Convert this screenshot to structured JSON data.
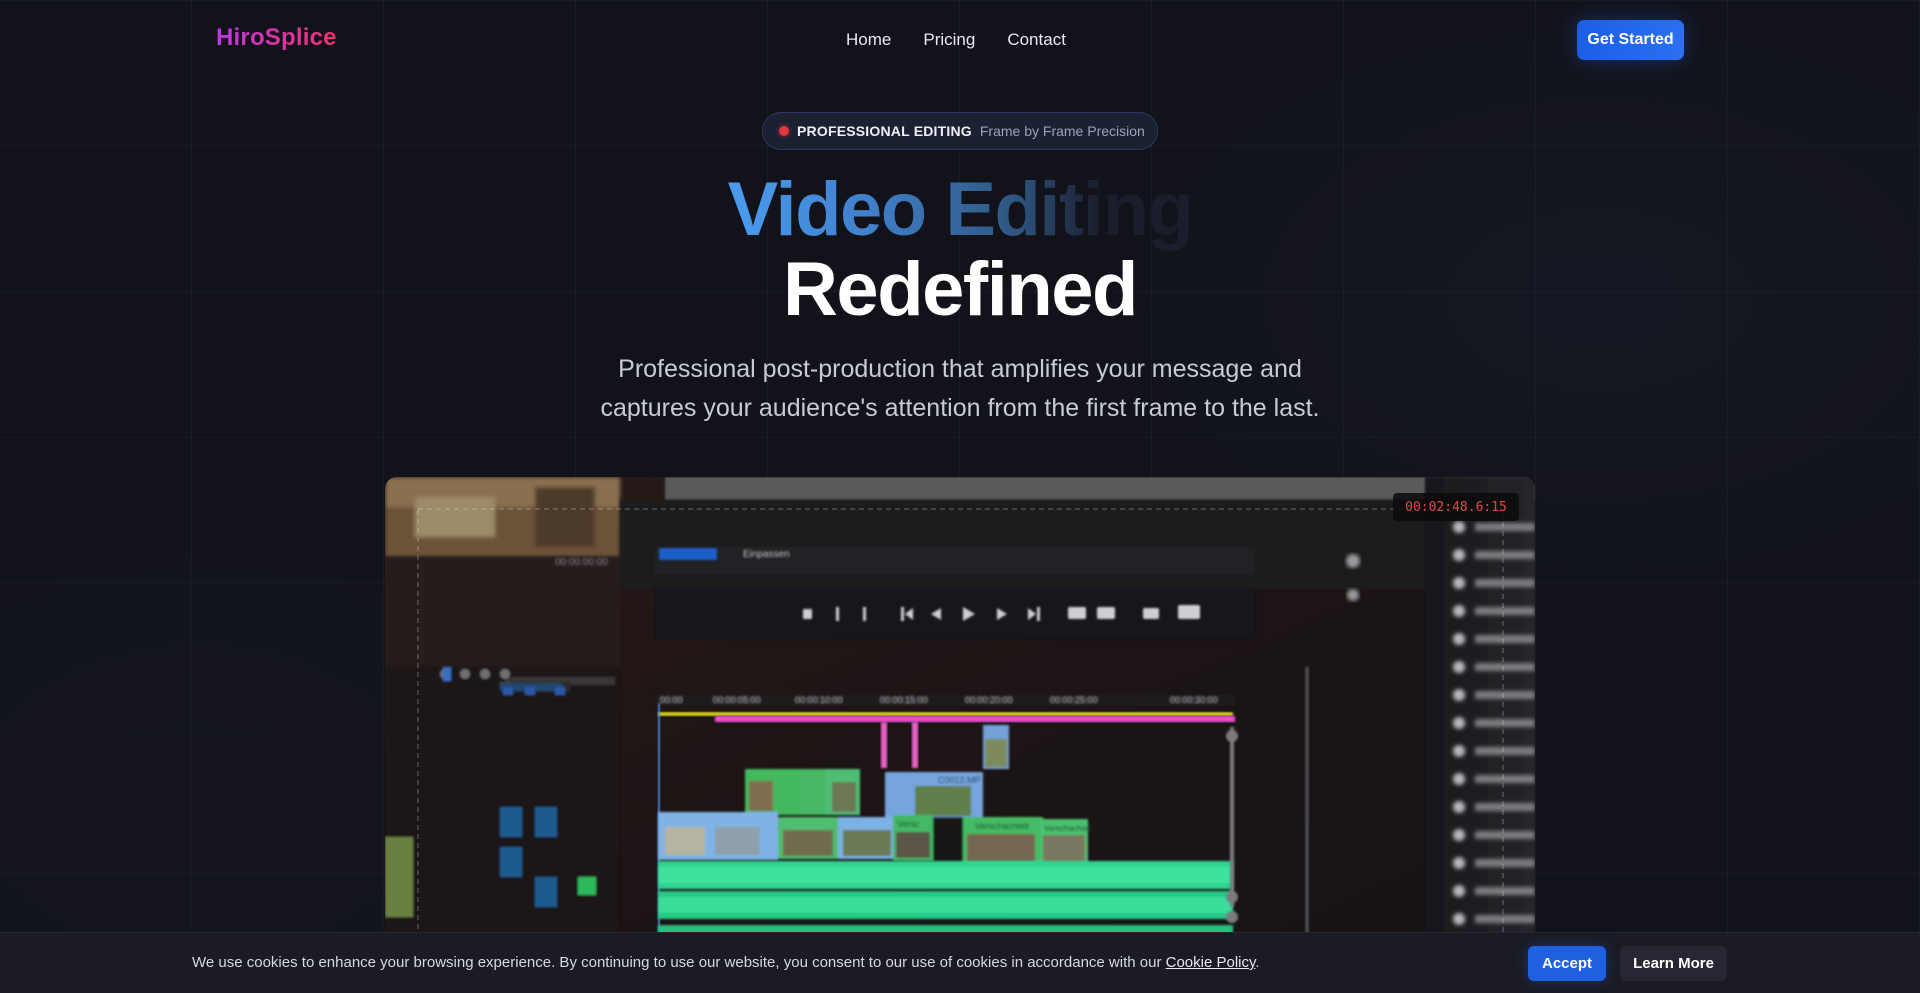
{
  "brand": {
    "name": "HiroSplice"
  },
  "nav": {
    "links": [
      {
        "label": "Home"
      },
      {
        "label": "Pricing"
      },
      {
        "label": "Contact"
      }
    ],
    "cta_label": "Get Started"
  },
  "hero": {
    "badge_main": "PROFESSIONAL EDITING",
    "badge_sub": "Frame by Frame Precision",
    "title_line1": "Video Editing",
    "title_line2": "Redefined",
    "subtitle_line1": "Professional post-production that amplifies your message and",
    "subtitle_line2": "captures your audience's attention from the first frame to the last."
  },
  "preview": {
    "timecode": "00:02:48.6:15",
    "editor_dropdown": "Einpassen",
    "editor_timecode_small": "00:00:00:00",
    "ruler_labels": [
      "00:00",
      "00:00:05:00",
      "00:00:10:00",
      "00:00:15:00",
      "00:00:20:00",
      "00:00:25:00",
      "00:00:30:00"
    ],
    "clip_labels": [
      "C0012.MP",
      "Verschachtelt",
      "Versc",
      "Verschachtelt"
    ]
  },
  "cookie": {
    "text": "We use cookies to enhance your browsing experience. By continuing to use our website, you consent to our use of cookies in accordance with our",
    "link_label": "Cookie Policy",
    "trailing": ".",
    "accept_label": "Accept",
    "learn_more_label": "Learn More"
  },
  "colors": {
    "background": "#12131a",
    "accent_blue": "#1f5fe0",
    "logo_gradient_start": "#c035e6",
    "logo_gradient_end": "#f0336b",
    "badge_dot": "#e2353d",
    "timecode_text": "#e04848"
  }
}
